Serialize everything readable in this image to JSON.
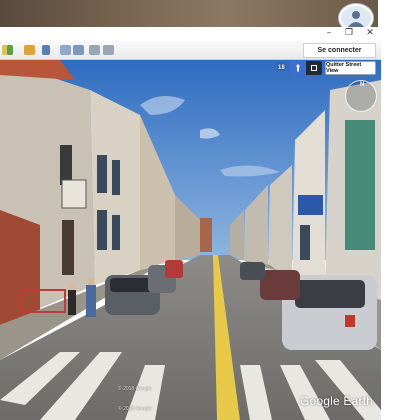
{
  "toolbar": {
    "connect_label": "Se connecter",
    "icons": [
      "folder-icon",
      "placemark-icon",
      "polygon-icon",
      "path-icon",
      "overlay-icon",
      "tour-icon",
      "historical-imagery-icon",
      "sun-icon",
      "planets-icon",
      "ruler-icon",
      "email-icon",
      "print-icon",
      "save-image-icon",
      "web-icon"
    ]
  },
  "window": {
    "minimize": "–",
    "maximize": "❐",
    "close": "✕"
  },
  "street_view": {
    "zoom_level": "18",
    "exit_label": "Quitter Street View",
    "compass_north": "N",
    "copyright_1": "© 2018 Google",
    "copyright_2": "© 2018 Google",
    "brand": "Google Earth"
  },
  "colors": {
    "sky": "#3c7bc9",
    "road_line": "#e6c84a",
    "accent": "#3b6fd1"
  }
}
